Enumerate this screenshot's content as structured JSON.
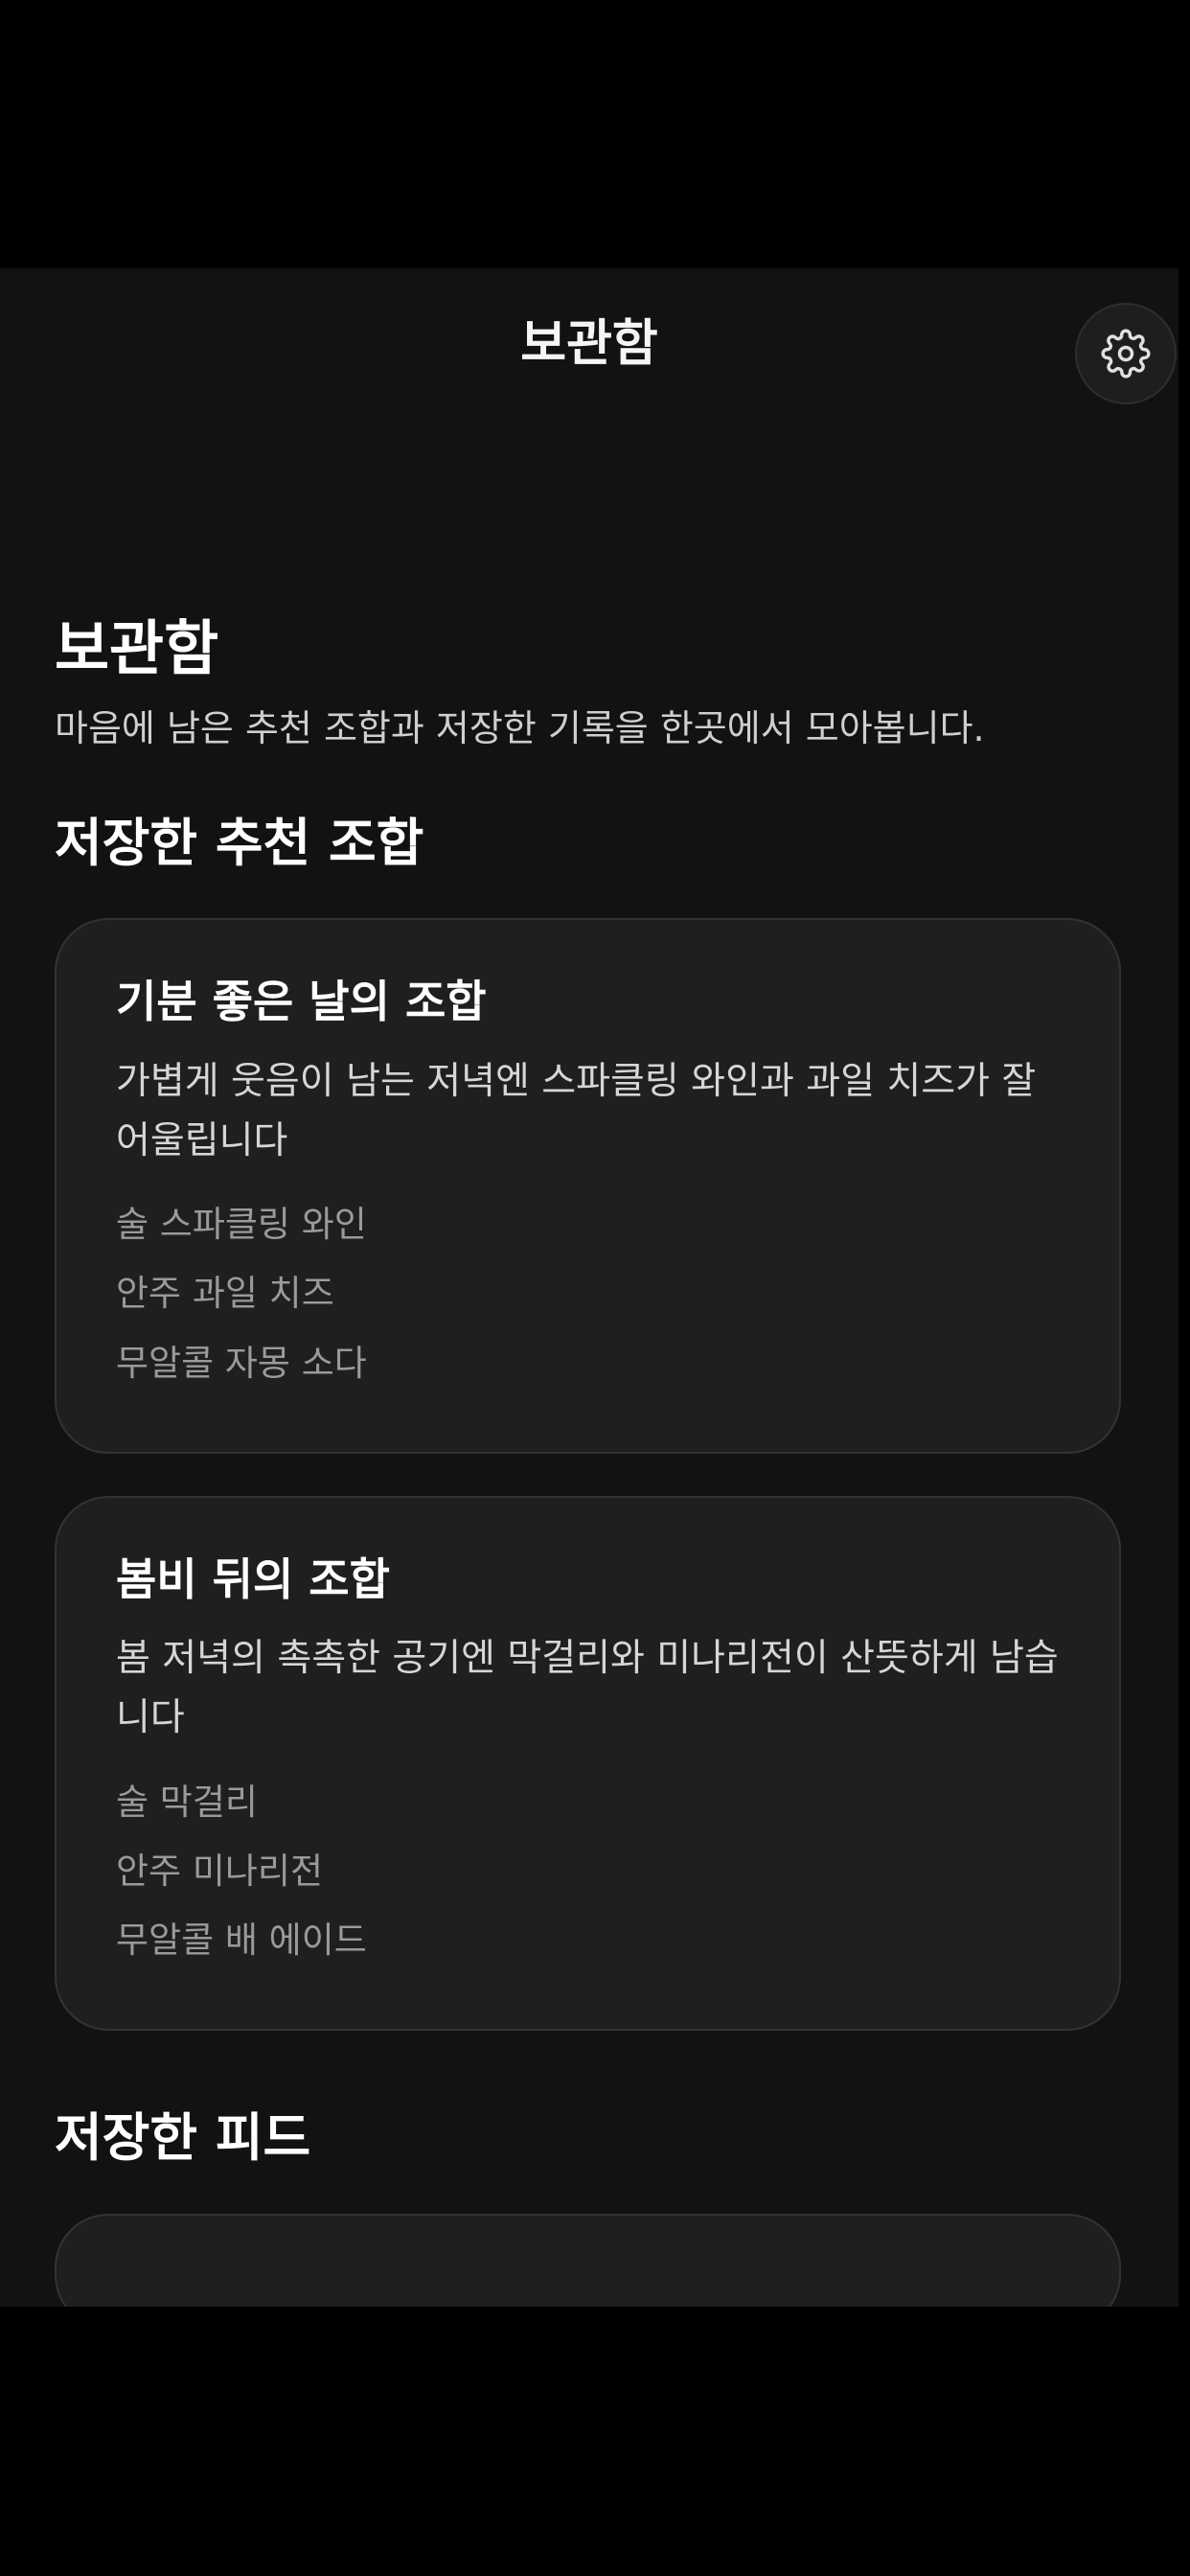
{
  "header": {
    "title": "보관함",
    "settings_icon": "gear-icon"
  },
  "page": {
    "title": "보관함",
    "description": "마음에 남은 추천 조합과 저장한 기록을 한곳에서 모아봅니다."
  },
  "saved_recipes": {
    "section_title": "저장한 추천 조합",
    "cards": [
      {
        "title": "기분 좋은 날의 조합",
        "description": "가볍게 웃음이 남는 저녁엔 스파클링 와인과 과일 치즈가 잘 어울립니다",
        "items": [
          "술 스파클링 와인",
          "안주 과일 치즈",
          "무알콜 자몽 소다"
        ]
      },
      {
        "title": "봄비 뒤의 조합",
        "description": "봄 저녁의 촉촉한 공기엔 막걸리와 미나리전이 산뜻하게 남습니다",
        "items": [
          "술 막걸리",
          "안주 미나리전",
          "무알콜 배 에이드"
        ]
      }
    ]
  },
  "saved_feed": {
    "section_title": "저장한 피드"
  },
  "colors": {
    "background": "#121212",
    "card": "#1f1f1f",
    "card_border": "#333333",
    "text_primary": "#ffffff",
    "text_secondary": "#d6d6d6",
    "text_muted": "#9a9a9a"
  }
}
